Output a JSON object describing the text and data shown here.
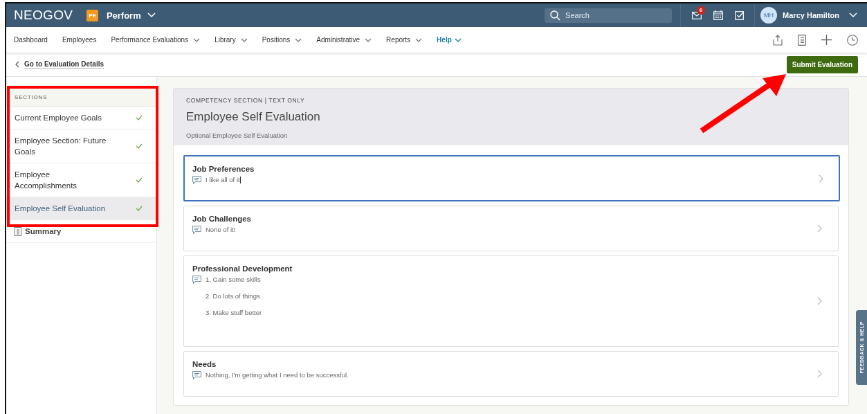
{
  "topbar": {
    "logo": "NEOGOV",
    "product_badge": "PE",
    "product": "Perform",
    "search": {
      "placeholder": "Search"
    },
    "mail_count": "6",
    "user": {
      "initials": "MH",
      "name": "Marcy Hamilton"
    }
  },
  "nav": [
    {
      "label": "Dashboard",
      "dropdown": false,
      "selected": false
    },
    {
      "label": "Employees",
      "dropdown": false,
      "selected": false
    },
    {
      "label": "Performance Evaluations",
      "dropdown": true,
      "selected": false
    },
    {
      "label": "Library",
      "dropdown": true,
      "selected": false
    },
    {
      "label": "Positions",
      "dropdown": true,
      "selected": false
    },
    {
      "label": "Administrative",
      "dropdown": true,
      "selected": false
    },
    {
      "label": "Reports",
      "dropdown": true,
      "selected": false
    },
    {
      "label": "Help",
      "dropdown": true,
      "selected": true
    }
  ],
  "back_link": "Go to Evaluation Details",
  "submit_button": "Submit Evaluation",
  "sidebar": {
    "heading": "SECTIONS",
    "items": [
      {
        "kind": "section",
        "label": "Current Employee Goals",
        "complete": true,
        "selected": false
      },
      {
        "kind": "section",
        "label": "Employee Section: Future Goals",
        "complete": true,
        "selected": false
      },
      {
        "kind": "section",
        "label": "Employee Accomplishments",
        "complete": true,
        "selected": false
      },
      {
        "kind": "section",
        "label": "Employee Self Evaluation",
        "complete": true,
        "selected": true
      },
      {
        "kind": "summary",
        "label": "Summary",
        "complete": false,
        "selected": false
      }
    ]
  },
  "section": {
    "eyebrow": "COMPETENCY SECTION | TEXT ONLY",
    "title": "Employee Self Evaluation",
    "subtitle": "Optional Employee Self Evaluation",
    "questions": [
      {
        "title": "Job Preferences",
        "selected": true,
        "answer": [
          "I like all of it"
        ]
      },
      {
        "title": "Job Challenges",
        "selected": false,
        "answer": [
          "None of it!"
        ]
      },
      {
        "title": "Professional Development",
        "selected": false,
        "answer": [
          "1. Gain some skills",
          "2. Do lots of things",
          "3. Make stuff better"
        ]
      },
      {
        "title": "Needs",
        "selected": false,
        "answer": [
          "Nothing, I'm getting what I need to be successful."
        ]
      }
    ]
  },
  "feedback_tab": "FEEDBACK & HELP",
  "annotations": {
    "highlight_box": true,
    "arrow": true
  }
}
